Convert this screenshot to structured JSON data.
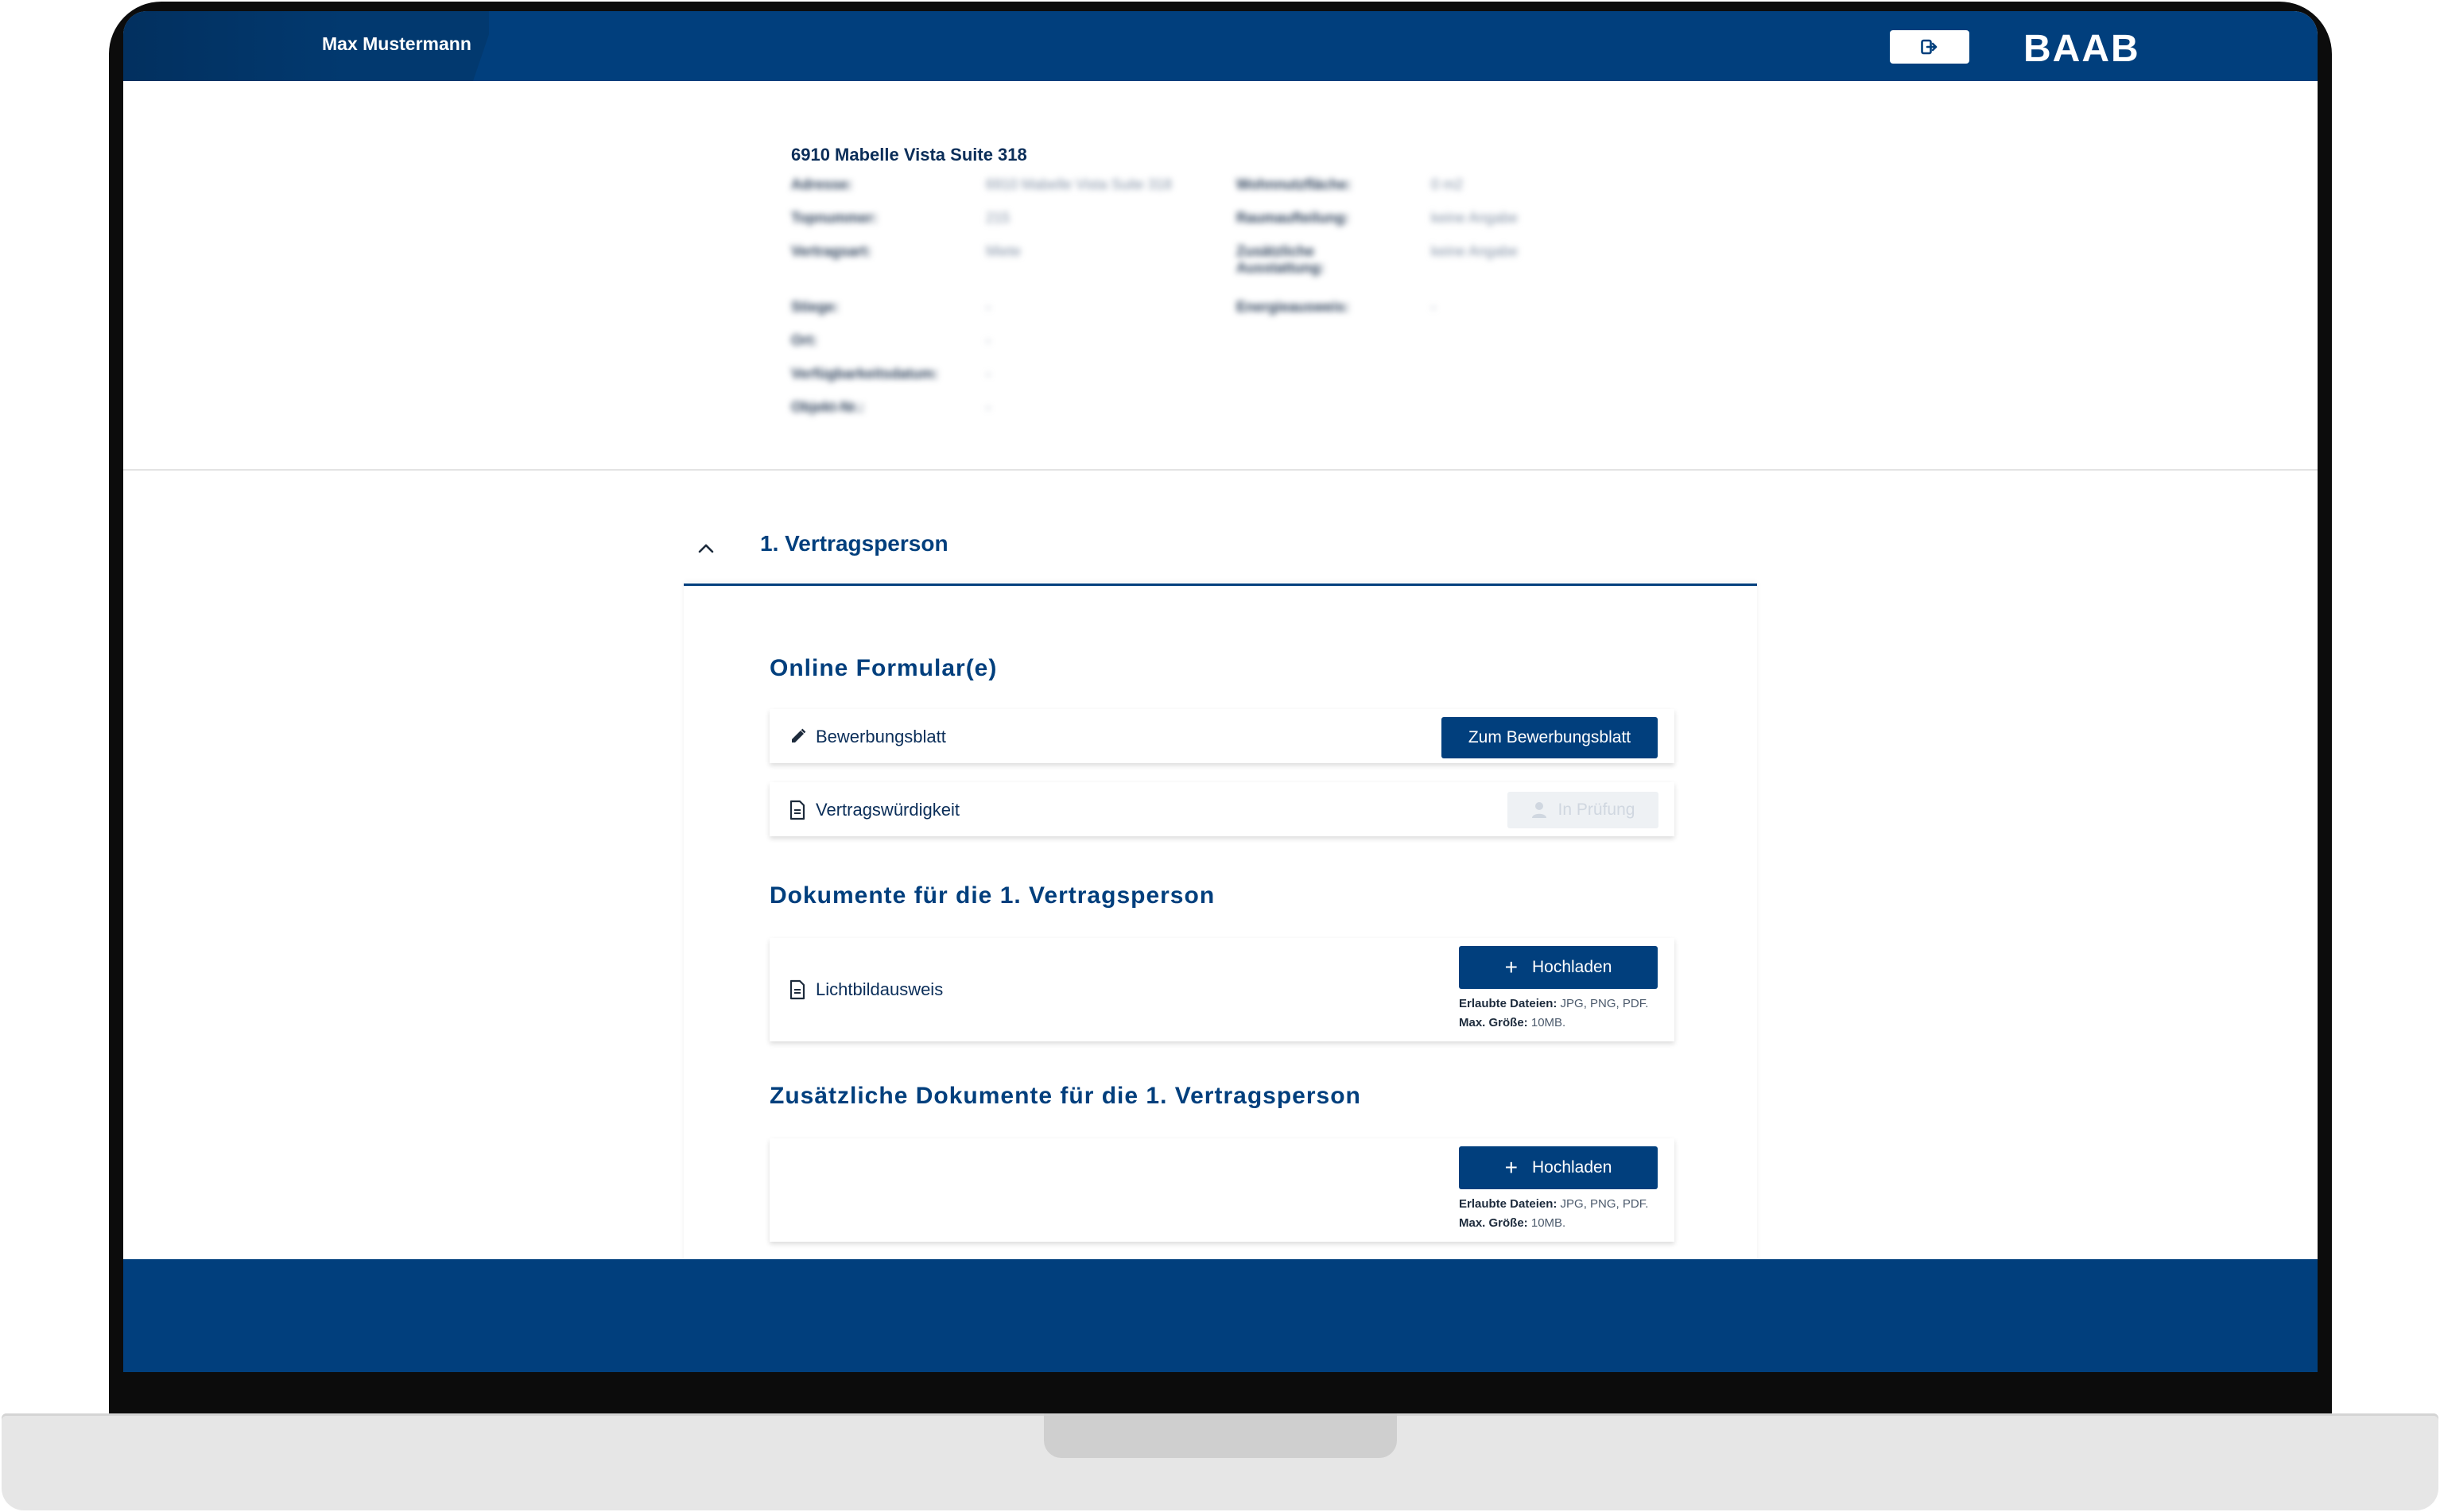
{
  "header": {
    "user_name": "Max Mustermann",
    "logo_text": "BAAB",
    "logout_icon": "logout-icon"
  },
  "property": {
    "title": "6910 Mabelle Vista Suite 318",
    "left_fields": [
      {
        "label": "Adresse:",
        "value": "6910 Mabelle Vista Suite 318"
      },
      {
        "label": "Topnummer:",
        "value": "215"
      },
      {
        "label": "Vertragsart:",
        "value": "Miete"
      },
      {
        "label": "Stiege:",
        "value": "-"
      },
      {
        "label": "Ort:",
        "value": "-"
      },
      {
        "label": "Verfügbarkeitsdatum:",
        "value": "-"
      },
      {
        "label": "Objekt-Nr.:",
        "value": "-"
      }
    ],
    "right_fields": [
      {
        "label": "Wohnnutzfläche:",
        "value": "0 m2"
      },
      {
        "label": "Raumaufteilung:",
        "value": "keine Angabe"
      },
      {
        "label": "Zusätzliche Ausstattung:",
        "value": "keine Angabe"
      },
      {
        "label": "Energieausweis:",
        "value": "-"
      }
    ]
  },
  "section": {
    "title": "1. Vertragsperson",
    "toggle_icon": "chevron-up-icon",
    "online_forms": {
      "heading": "Online Formular(e)",
      "items": [
        {
          "label": "Bewerbungsblatt",
          "icon": "pencil-icon",
          "button_label": "Zum Bewerbungsblatt"
        },
        {
          "label": "Vertragswürdigkeit",
          "icon": "document-icon",
          "button_label": "In Prüfung",
          "button_icon": "user-check-icon"
        }
      ]
    },
    "documents": {
      "heading": "Dokumente für die 1. Vertragsperson",
      "items": [
        {
          "label": "Lichtbildausweis",
          "icon": "document-icon",
          "button_label": "Hochladen",
          "allowed_label": "Erlaubte Dateien:",
          "allowed_value": "JPG, PNG, PDF.",
          "size_label": "Max. Größe:",
          "size_value": "10MB."
        }
      ]
    },
    "additional_documents": {
      "heading": "Zusätzliche Dokumente für die 1. Vertragsperson",
      "button_label": "Hochladen",
      "allowed_label": "Erlaubte Dateien:",
      "allowed_value": "JPG, PNG, PDF.",
      "size_label": "Max. Größe:",
      "size_value": "10MB."
    }
  },
  "colors": {
    "brand": "#013f7d",
    "text_dark": "#0b2e59",
    "disabled_bg": "#eef1f4"
  }
}
